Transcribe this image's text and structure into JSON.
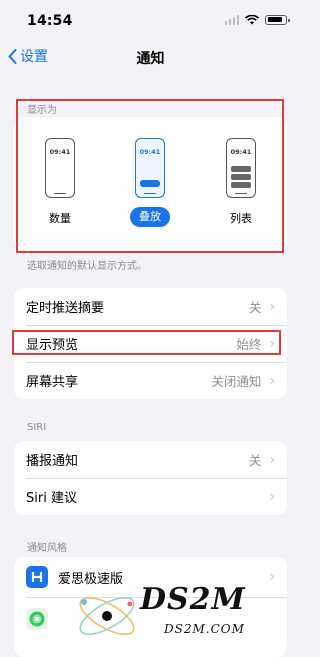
{
  "status_bar": {
    "time": "14:54"
  },
  "nav": {
    "back_label": "设置",
    "title": "通知"
  },
  "display_as": {
    "section_label": "显示为",
    "phone_time": "09:41",
    "options": [
      {
        "label": "数量",
        "selected": false
      },
      {
        "label": "叠放",
        "selected": true
      },
      {
        "label": "列表",
        "selected": false
      }
    ],
    "footer": "选取通知的默认显示方式。"
  },
  "general_rows": [
    {
      "label": "定时推送摘要",
      "value": "关"
    },
    {
      "label": "显示预览",
      "value": "始终"
    },
    {
      "label": "屏幕共享",
      "value": "关闭通知"
    }
  ],
  "siri": {
    "section_label": "SIRI",
    "rows": [
      {
        "label": "播报通知",
        "value": "关"
      },
      {
        "label": "Siri 建议",
        "value": ""
      }
    ]
  },
  "notification_style": {
    "section_label": "通知风格",
    "apps": [
      {
        "name": "爱思极速版",
        "icon": "aisi-app-icon"
      },
      {
        "name": "",
        "icon": "find-my-app-icon"
      }
    ]
  },
  "watermark": {
    "text": "DS2M",
    "subtext": "DS2M.COM"
  },
  "colors": {
    "accent": "#1a73e8",
    "highlight": "#e23b3b",
    "background": "#f2f2f7"
  }
}
